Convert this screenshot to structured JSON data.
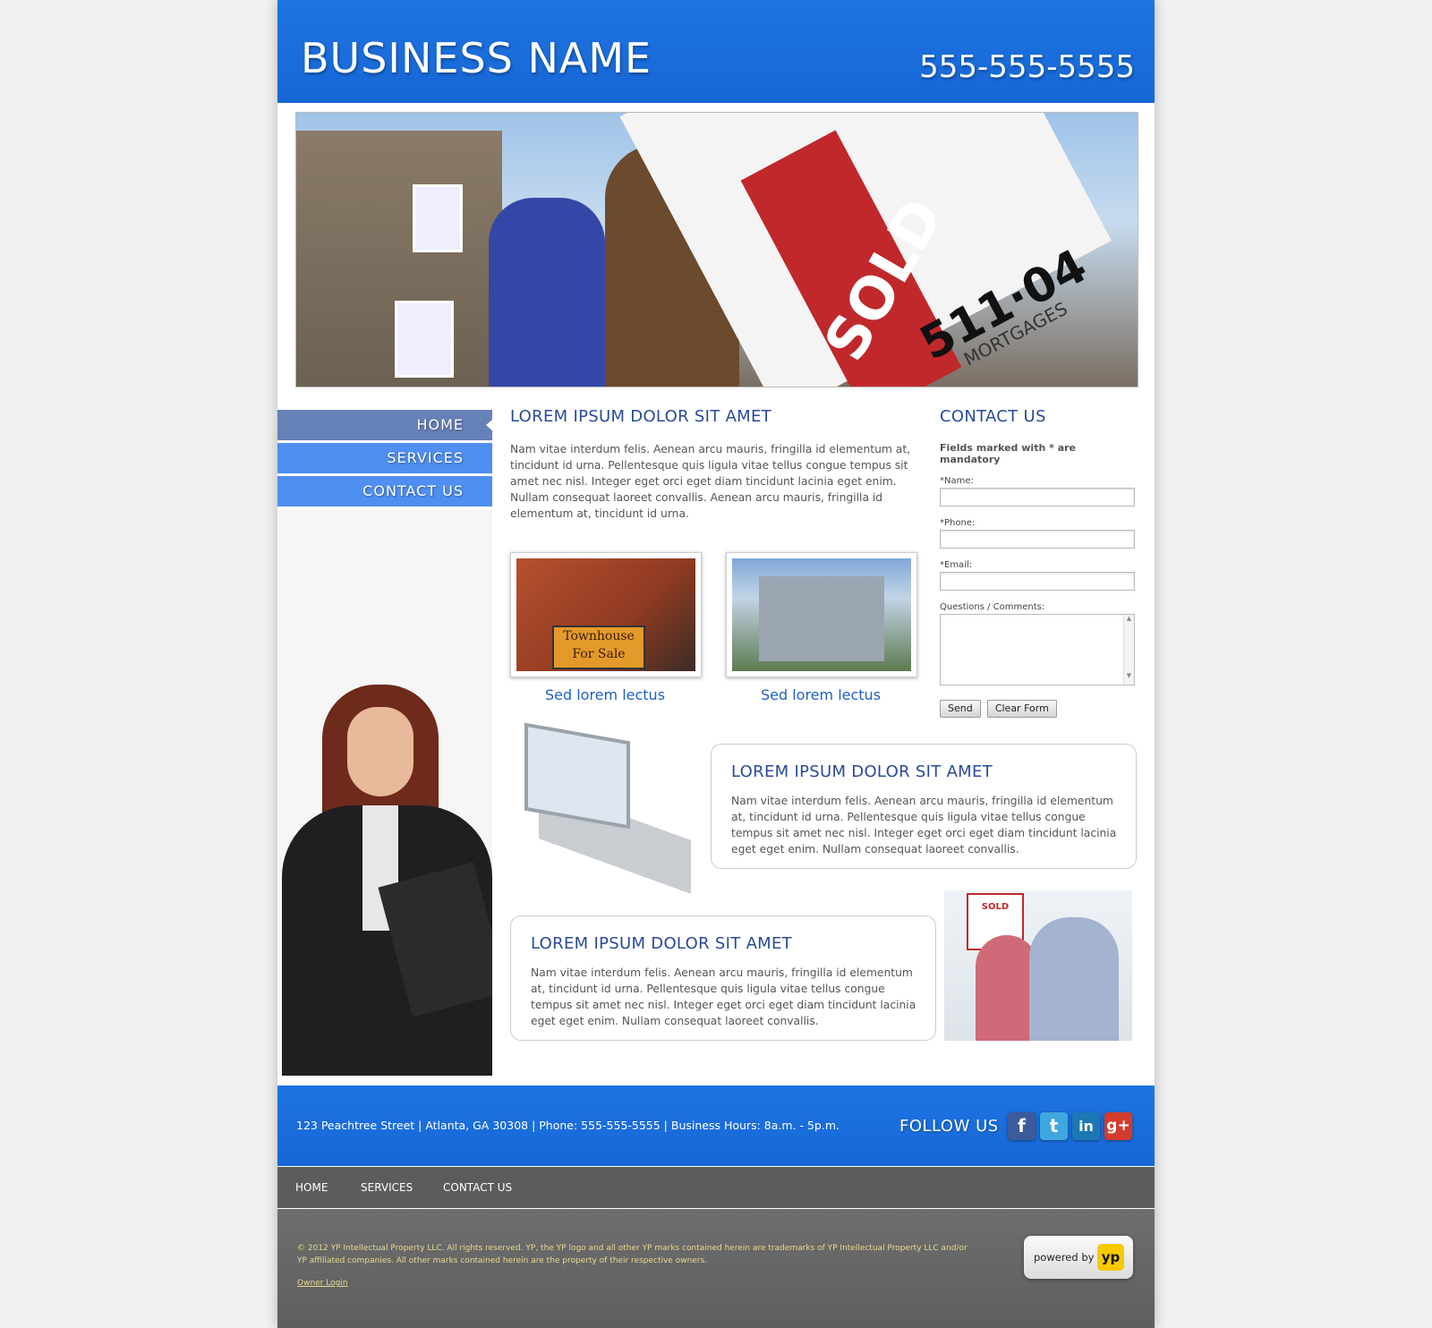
{
  "header": {
    "business_name": "BUSINESS NAME",
    "phone": "555-555-5555"
  },
  "hero": {
    "sign_sold": "SOLD",
    "sign_number": "511·04",
    "sign_small": "MORTGAGES"
  },
  "nav": {
    "items": [
      {
        "label": "HOME"
      },
      {
        "label": "SERVICES"
      },
      {
        "label": "CONTACT US"
      }
    ]
  },
  "main": {
    "title": "LOREM IPSUM DOLOR SIT AMET",
    "text": "Nam vitae interdum felis. Aenean arcu mauris, fringilla id elementum at, tincidunt id urna. Pellentesque quis ligula vitae tellus congue tempus sit amet nec nisl. Integer eget orci eget diam tincidunt lacinia eget enim. Nullam consequat laoreet convallis. Aenean arcu mauris, fringilla id elementum at, tincidunt id urna.",
    "thumbs": [
      {
        "caption": "Sed lorem lectus",
        "sign": "Townhouse For Sale"
      },
      {
        "caption": "Sed lorem lectus"
      }
    ]
  },
  "contact": {
    "title": "CONTACT US",
    "mandatory_note": "Fields marked with * are mandatory",
    "name_label": "*Name:",
    "phone_label": "*Phone:",
    "email_label": "*Email:",
    "comments_label": "Questions / Comments:",
    "send": "Send",
    "clear": "Clear Form"
  },
  "boxes": [
    {
      "title": "LOREM IPSUM DOLOR SIT AMET",
      "text": "Nam vitae interdum felis. Aenean arcu mauris, fringilla id elementum at, tincidunt id urna. Pellentesque quis ligula vitae tellus congue tempus sit amet nec nisl. Integer eget orci eget diam tincidunt lacinia eget eget enim. Nullam consequat laoreet convallis."
    },
    {
      "title": "LOREM IPSUM DOLOR SIT AMET",
      "text": "Nam vitae interdum felis. Aenean arcu mauris, fringilla id elementum at, tincidunt id urna. Pellentesque quis ligula vitae tellus congue tempus sit amet nec nisl. Integer eget orci eget diam tincidunt lacinia eget eget enim. Nullam consequat laoreet convallis."
    }
  ],
  "couple_sign": "SOLD",
  "footer": {
    "address": "123 Peachtree Street | Atlanta, GA 30308 | Phone: 555-555-5555 | Business Hours: 8a.m. - 5p.m.",
    "follow": "FOLLOW US",
    "social": {
      "facebook": "f",
      "twitter": "t",
      "linkedin": "in",
      "google": "g+"
    }
  },
  "bottom_nav": {
    "home": "HOME",
    "services": "SERVICES",
    "contact": "CONTACT US"
  },
  "bottom": {
    "copyright": "© 2012 YP Intellectual Property LLC. All rights reserved. YP, the YP logo and all other YP marks contained herein are trademarks of YP Intellectual Property LLC and/or YP affiliated companies. All other marks contained herein are the property of their respective owners.",
    "owner_login": "Owner Login",
    "powered_by": "powered by",
    "yp": "yp"
  },
  "colors": {
    "brand_blue": "#1b6fdd",
    "nav_active": "#6680b8",
    "nav_item": "#4f8ff2",
    "heading": "#2a4a9a"
  }
}
